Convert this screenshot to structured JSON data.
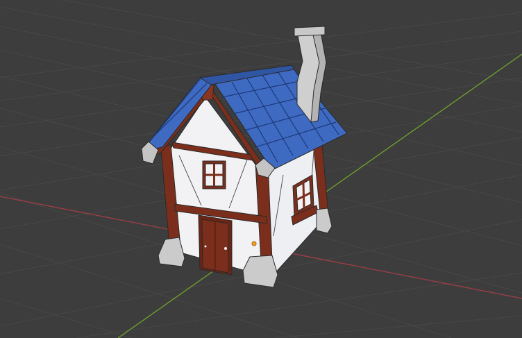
{
  "viewport": {
    "type": "3d-viewport",
    "object": "cottage-model",
    "colors": {
      "background": "#3d3d3d",
      "grid_line": "#4a4a4a",
      "x_axis": "#9a3e46",
      "y_axis": "#6e9a2f",
      "plaster_wall": "#f1f1f3",
      "timber_frame": "#7a2d1b",
      "roof_tiles": "#3d69c1",
      "stone": "#c9c9c9",
      "door": "#7a2d1b",
      "origin_dot": "#f29c1f"
    },
    "icons": [
      "origin-dot-icon"
    ]
  }
}
